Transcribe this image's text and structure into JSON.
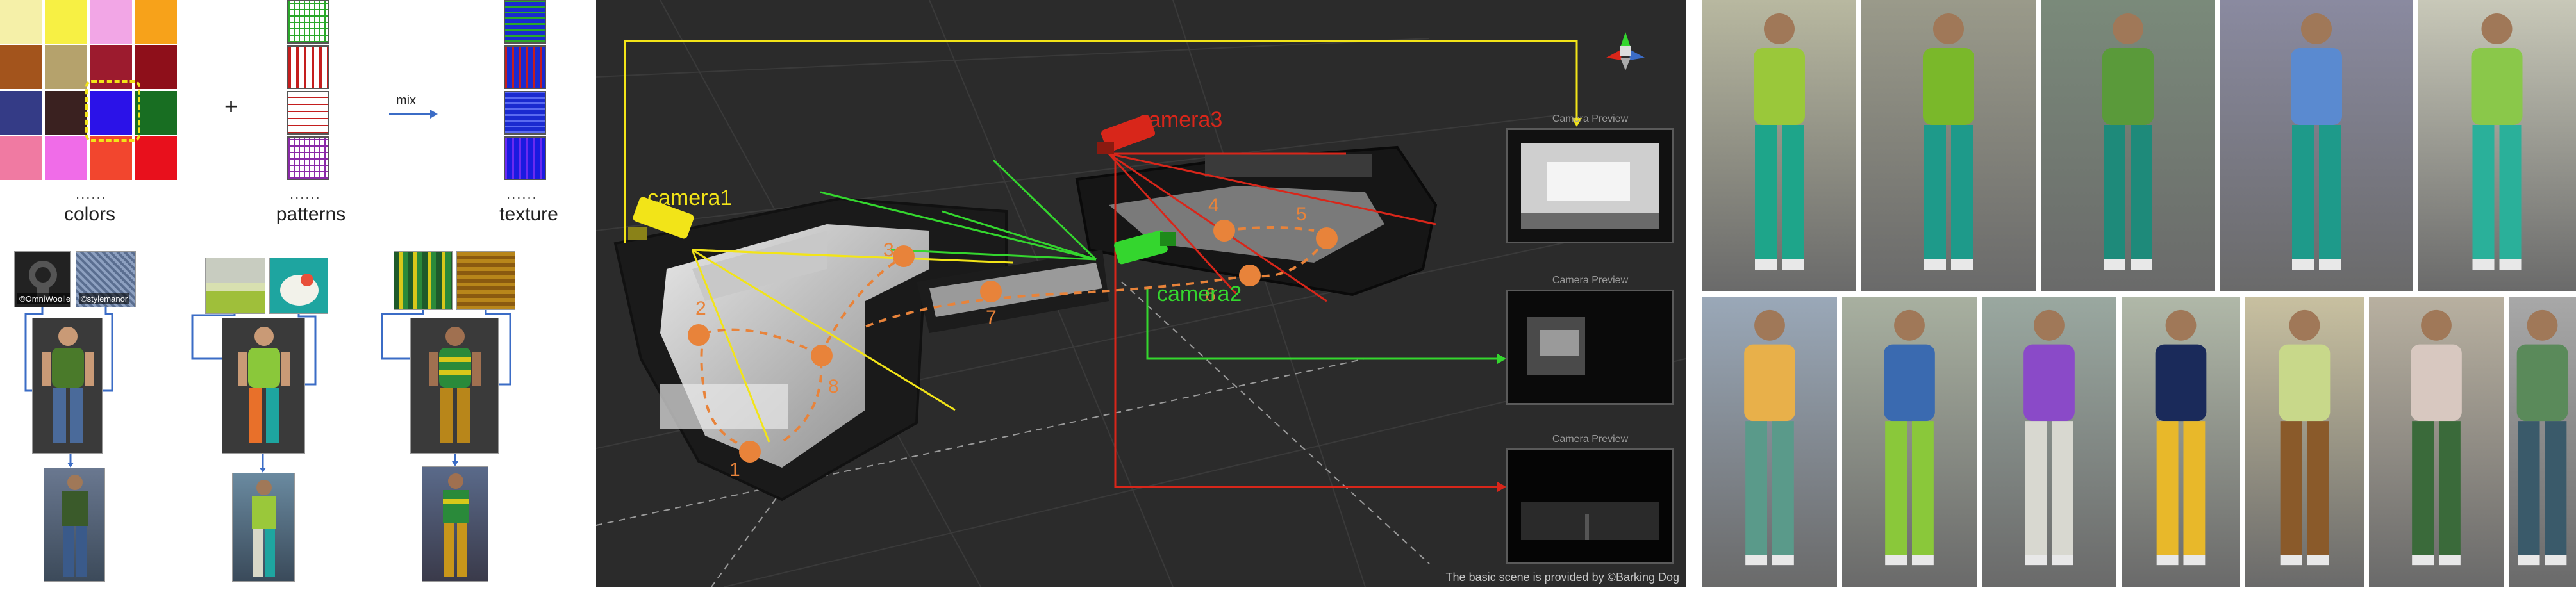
{
  "left_panel": {
    "colors_caption": "colors",
    "patterns_caption": "patterns",
    "texture_caption": "texture",
    "dots": "......",
    "plus_symbol": "+",
    "mix_label": "mix",
    "color_grid": [
      [
        "#f5f0a8",
        "#f7f044",
        "#f2a6e6",
        "#f7a21a"
      ],
      [
        "#a3541c",
        "#b5a26c",
        "#9c1b2e",
        "#8e0f1a"
      ],
      [
        "#343b86",
        "#3a2120",
        "#2b12e8",
        "#186e22"
      ],
      [
        "#f07aa2",
        "#f06ce8",
        "#f2462e",
        "#e8101c"
      ]
    ],
    "patterns": [
      {
        "name": "pattern-green-grid",
        "color": "#2aa82a"
      },
      {
        "name": "pattern-red-stripes",
        "color": "#c41e1e"
      },
      {
        "name": "pattern-red-lines",
        "color": "#c41e1e"
      },
      {
        "name": "pattern-purple-grid",
        "color": "#8a2aa8"
      }
    ],
    "textures": [
      {
        "name": "texture-green-blue",
        "a": "#1a2ad0",
        "b": "#2aa82a"
      },
      {
        "name": "texture-red-blue",
        "a": "#1a2ad0",
        "b": "#c41e1e"
      },
      {
        "name": "texture-blue-lines",
        "a": "#1a2ad0",
        "b": "#5a6af0"
      },
      {
        "name": "texture-blue-grid",
        "a": "#1a1ae0",
        "b": "#6a2af0"
      }
    ],
    "thumb_labels": {
      "c1a": "©OmniWoollen",
      "c1b": "©stylemanor"
    }
  },
  "scene": {
    "camera1": "camera1",
    "camera2": "camera2",
    "camera3": "camera3",
    "numbers": [
      "1",
      "2",
      "3",
      "4",
      "5",
      "6",
      "7",
      "8"
    ],
    "preview_title": "Camera Preview",
    "credit": "The basic scene is provided by ©Barking Dog",
    "colors": {
      "camera1": "#f2e418",
      "camera2": "#34d62e",
      "camera3": "#d8261a",
      "path": "#e8833a"
    }
  }
}
